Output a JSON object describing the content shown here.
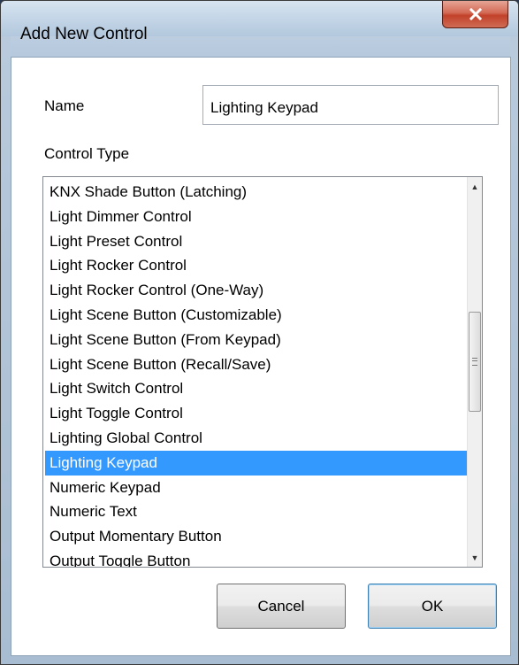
{
  "window": {
    "title": "Add New Control",
    "close_symbol": "X"
  },
  "form": {
    "name_label": "Name",
    "name_value": "Lighting Keypad",
    "control_type_label": "Control Type"
  },
  "list": {
    "items": [
      "KNX Shade Button (Latching)",
      "Light Dimmer Control",
      "Light Preset Control",
      "Light Rocker Control",
      "Light Rocker Control (One-Way)",
      "Light Scene Button (Customizable)",
      "Light Scene Button (From Keypad)",
      "Light Scene Button (Recall/Save)",
      "Light Switch Control",
      "Light Toggle Control",
      "Lighting Global Control",
      "Lighting Keypad",
      "Numeric Keypad",
      "Numeric Text",
      "Output Momentary Button",
      "Output Toggle Button"
    ],
    "selected": "Lighting Keypad",
    "selected_color": "#3399ff"
  },
  "buttons": {
    "cancel": "Cancel",
    "ok": "OK"
  },
  "icons": {
    "close": "close-icon",
    "scroll_up": "scroll-up-arrow-icon",
    "scroll_down": "scroll-down-arrow-icon",
    "grip": "scroll-grip-icon"
  }
}
